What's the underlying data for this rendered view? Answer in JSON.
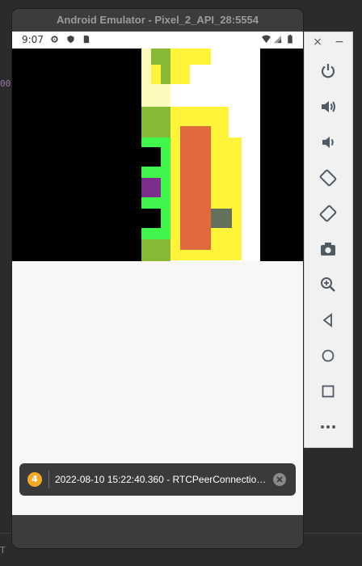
{
  "ide": {
    "code_fragment": "00,",
    "bottom_fragment": "T"
  },
  "emulator": {
    "title": "Android Emulator - Pixel_2_API_28:5554",
    "status_bar": {
      "time": "9:07"
    },
    "toast": {
      "badge_count": "4",
      "message": "2022-08-10 15:22:40.360 - RTCPeerConnection..."
    }
  },
  "side_panel": {
    "close_label": "×",
    "minimize_label": "−",
    "buttons": [
      "power-icon",
      "volume-up-icon",
      "volume-down-icon",
      "rotate-left-icon",
      "rotate-right-icon",
      "camera-icon",
      "zoom-icon",
      "back-icon",
      "home-icon",
      "overview-icon",
      "more-icon"
    ]
  },
  "colors": {
    "emulator_frame": "#3c3c3c",
    "toast_badge": "#f3a82a",
    "side_panel": "#f1f1f1"
  }
}
